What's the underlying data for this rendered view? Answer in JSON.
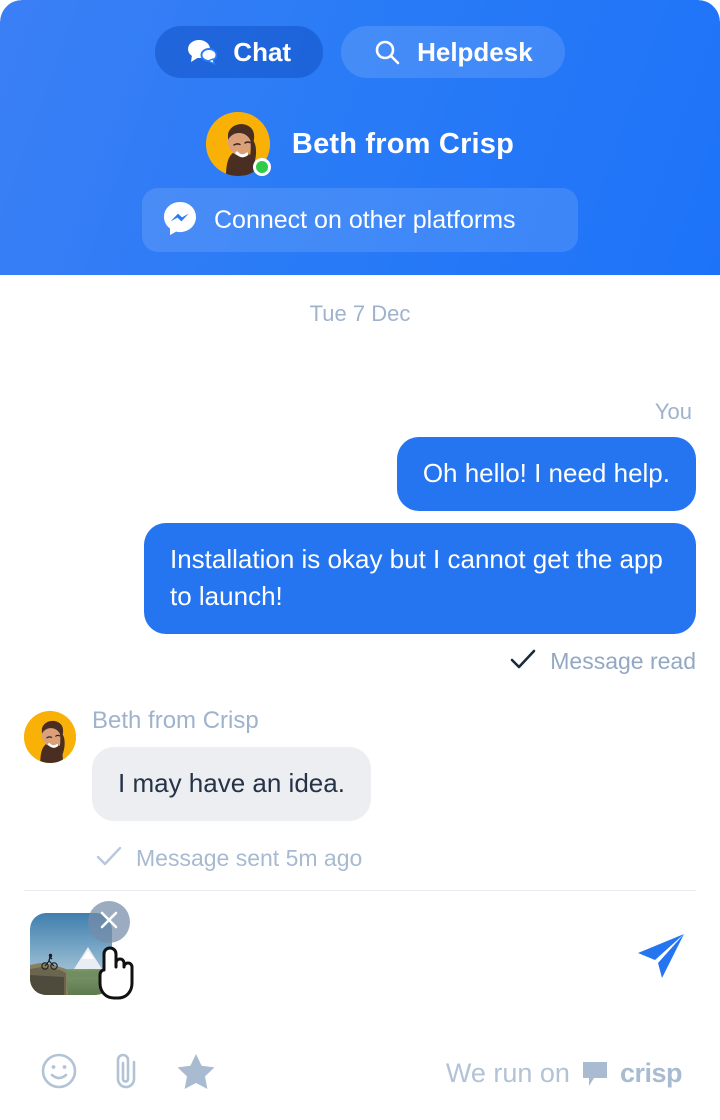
{
  "header": {
    "tabs": [
      {
        "label": "Chat",
        "icon": "chat-bubbles-icon",
        "active": true
      },
      {
        "label": "Helpdesk",
        "icon": "search-icon",
        "active": false
      }
    ],
    "agent": {
      "name": "Beth from Crisp",
      "avatar": "agent-avatar",
      "presence": "online",
      "presence_color": "#2fcc48",
      "avatar_bg": "#f9b108"
    },
    "connect": {
      "label": "Connect on other platforms",
      "icon": "messenger-icon"
    },
    "gradient_from": "#3b7ff5",
    "gradient_to": "#1d73f8"
  },
  "conversation": {
    "day_separator": "Tue 7 Dec",
    "outgoing": {
      "sender_label": "You",
      "messages": [
        "Oh hello! I need help.",
        "Installation is okay but I cannot get the app to launch!"
      ],
      "status": "Message read",
      "status_icon": "check-icon",
      "bubble_color": "#2575f0"
    },
    "incoming": {
      "sender_label": "Beth from Crisp",
      "messages": [
        "I may have an idea."
      ],
      "status": "Message sent 5m ago",
      "status_icon": "check-icon",
      "bubble_color": "#eceef2"
    }
  },
  "composer": {
    "attachment": {
      "name": "attachment-thumbnail",
      "remove_icon": "close-icon",
      "alt": "mountain-biker-on-cliff"
    },
    "cursor": "pointer-hand-cursor",
    "send_icon": "send-plane-icon",
    "send_color": "#2575f0"
  },
  "footer": {
    "tools": [
      {
        "icon": "emoji-icon",
        "name": "emoji-picker-button"
      },
      {
        "icon": "paperclip-icon",
        "name": "attach-file-button"
      },
      {
        "icon": "star-icon",
        "name": "rate-conversation-button"
      }
    ],
    "branding": {
      "text": "We run on",
      "name": "crisp",
      "icon": "crisp-logo-icon"
    },
    "icon_color": "#b3c3d6"
  }
}
